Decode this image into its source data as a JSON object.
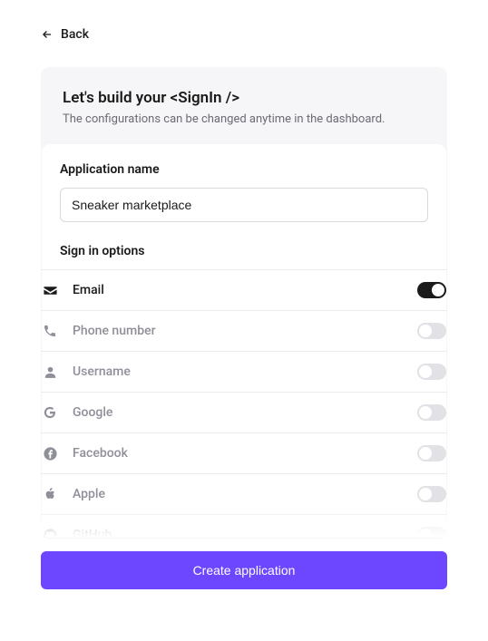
{
  "back": {
    "label": "Back"
  },
  "header": {
    "title": "Let's build your <SignIn />",
    "subtitle": "The configurations can be changed anytime in the dashboard."
  },
  "appName": {
    "label": "Application name",
    "value": "Sneaker marketplace"
  },
  "signInOptions": {
    "label": "Sign in options",
    "items": [
      {
        "icon": "email-icon",
        "label": "Email",
        "enabled": true
      },
      {
        "icon": "phone-icon",
        "label": "Phone number",
        "enabled": false
      },
      {
        "icon": "username-icon",
        "label": "Username",
        "enabled": false
      },
      {
        "icon": "google-icon",
        "label": "Google",
        "enabled": false
      },
      {
        "icon": "facebook-icon",
        "label": "Facebook",
        "enabled": false
      },
      {
        "icon": "apple-icon",
        "label": "Apple",
        "enabled": false
      },
      {
        "icon": "github-icon",
        "label": "GitHub",
        "enabled": false
      }
    ]
  },
  "submit": {
    "label": "Create application"
  },
  "colors": {
    "primary": "#6c47ff"
  }
}
